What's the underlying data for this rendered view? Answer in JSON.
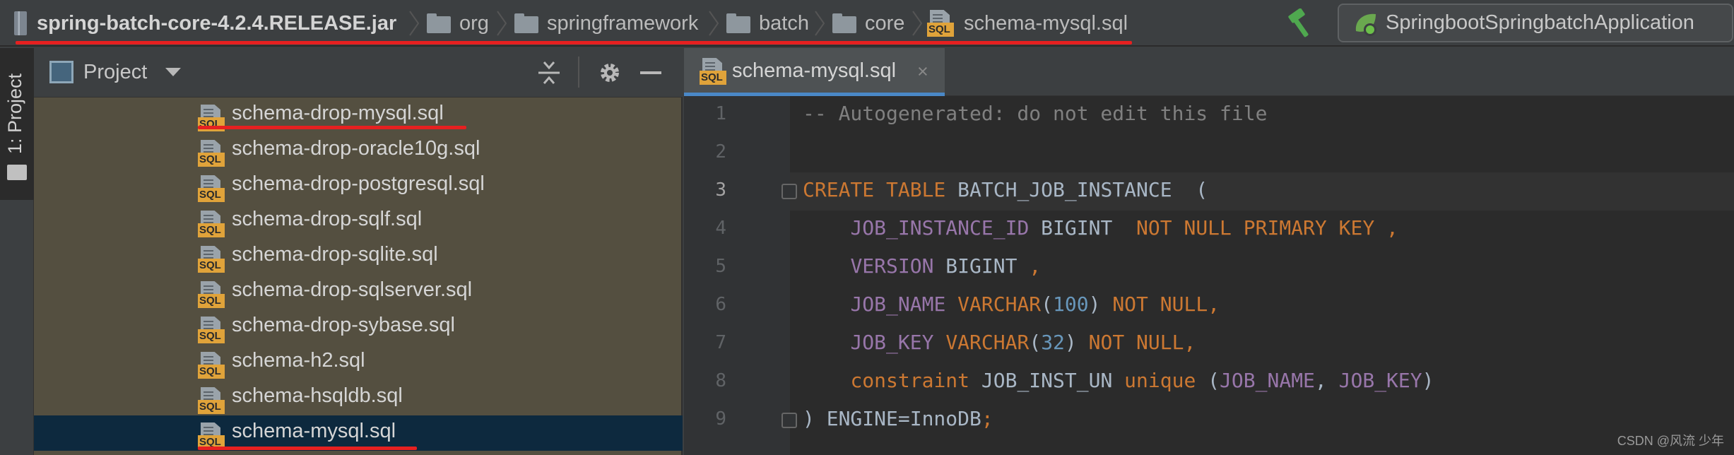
{
  "breadcrumb": {
    "items": [
      {
        "label": "spring-batch-core-4.2.4.RELEASE.jar",
        "icon": "jar-icon"
      },
      {
        "label": "org",
        "icon": "folder-icon"
      },
      {
        "label": "springframework",
        "icon": "folder-icon"
      },
      {
        "label": "batch",
        "icon": "folder-icon"
      },
      {
        "label": "core",
        "icon": "folder-icon"
      },
      {
        "label": "schema-mysql.sql",
        "icon": "sql-file-icon"
      }
    ]
  },
  "toolbar": {
    "build_icon": "hammer-icon",
    "run_config": "SpringbootSpringbatchApplication"
  },
  "toolstrip": {
    "project_tab_label": "1: Project"
  },
  "project_panel": {
    "title": "Project",
    "files": [
      {
        "name": "schema-drop-mysql.sql",
        "selected": false
      },
      {
        "name": "schema-drop-oracle10g.sql",
        "selected": false
      },
      {
        "name": "schema-drop-postgresql.sql",
        "selected": false
      },
      {
        "name": "schema-drop-sqlf.sql",
        "selected": false
      },
      {
        "name": "schema-drop-sqlite.sql",
        "selected": false
      },
      {
        "name": "schema-drop-sqlserver.sql",
        "selected": false
      },
      {
        "name": "schema-drop-sybase.sql",
        "selected": false
      },
      {
        "name": "schema-h2.sql",
        "selected": false
      },
      {
        "name": "schema-hsqldb.sql",
        "selected": false
      },
      {
        "name": "schema-mysql.sql",
        "selected": true
      }
    ],
    "file_badge": "SQL"
  },
  "editor": {
    "active_tab": "schema-mysql.sql",
    "close_glyph": "×",
    "current_line": 3,
    "lines": [
      {
        "num": "1",
        "tokens": [
          {
            "t": "-- Autogenerated: do not edit this file",
            "c": "comment"
          }
        ]
      },
      {
        "num": "2",
        "tokens": []
      },
      {
        "num": "3",
        "tokens": [
          {
            "t": "CREATE TABLE ",
            "c": "kw"
          },
          {
            "t": "BATCH_JOB_INSTANCE  (",
            "c": "id"
          }
        ]
      },
      {
        "num": "4",
        "tokens": [
          {
            "t": "    ",
            "c": "id"
          },
          {
            "t": "JOB_INSTANCE_ID",
            "c": "col"
          },
          {
            "t": " BIGINT  ",
            "c": "id"
          },
          {
            "t": "NOT NULL PRIMARY KEY ,",
            "c": "kw"
          }
        ]
      },
      {
        "num": "5",
        "tokens": [
          {
            "t": "    ",
            "c": "id"
          },
          {
            "t": "VERSION",
            "c": "col"
          },
          {
            "t": " BIGINT ",
            "c": "id"
          },
          {
            "t": ",",
            "c": "kw"
          }
        ]
      },
      {
        "num": "6",
        "tokens": [
          {
            "t": "    ",
            "c": "id"
          },
          {
            "t": "JOB_NAME",
            "c": "col"
          },
          {
            "t": " ",
            "c": "id"
          },
          {
            "t": "VARCHAR",
            "c": "kw"
          },
          {
            "t": "(",
            "c": "id"
          },
          {
            "t": "100",
            "c": "num"
          },
          {
            "t": ") ",
            "c": "id"
          },
          {
            "t": "NOT NULL,",
            "c": "kw"
          }
        ]
      },
      {
        "num": "7",
        "tokens": [
          {
            "t": "    ",
            "c": "id"
          },
          {
            "t": "JOB_KEY",
            "c": "col"
          },
          {
            "t": " ",
            "c": "id"
          },
          {
            "t": "VARCHAR",
            "c": "kw"
          },
          {
            "t": "(",
            "c": "id"
          },
          {
            "t": "32",
            "c": "num"
          },
          {
            "t": ") ",
            "c": "id"
          },
          {
            "t": "NOT NULL,",
            "c": "kw"
          }
        ]
      },
      {
        "num": "8",
        "tokens": [
          {
            "t": "    ",
            "c": "id"
          },
          {
            "t": "constraint",
            "c": "kw"
          },
          {
            "t": " JOB_INST_UN ",
            "c": "id"
          },
          {
            "t": "unique",
            "c": "kw"
          },
          {
            "t": " (",
            "c": "id"
          },
          {
            "t": "JOB_NAME",
            "c": "col"
          },
          {
            "t": ", ",
            "c": "id"
          },
          {
            "t": "JOB_KEY",
            "c": "col"
          },
          {
            "t": ")",
            "c": "id"
          }
        ]
      },
      {
        "num": "9",
        "tokens": [
          {
            "t": ") ENGINE=InnoDB",
            "c": "id"
          },
          {
            "t": ";",
            "c": "kw"
          }
        ]
      }
    ]
  },
  "watermark": "CSDN @风流 少年",
  "colors": {
    "accent_underline": "#4a88c7",
    "annotation_red": "#e62020",
    "keyword": "#cc7832",
    "column": "#9876aa",
    "number": "#6897bb",
    "comment": "#808080"
  }
}
